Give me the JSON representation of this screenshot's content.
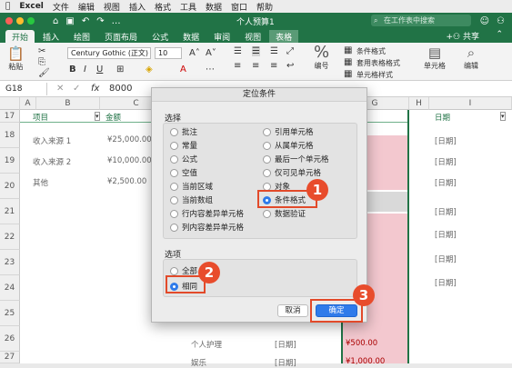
{
  "menubar": {
    "apple": "",
    "items": [
      "Excel",
      "文件",
      "编辑",
      "视图",
      "插入",
      "格式",
      "工具",
      "数据",
      "窗口",
      "帮助"
    ]
  },
  "window": {
    "title": "个人预算1",
    "search_placeholder": "在工作表中搜索",
    "share_label": "共享"
  },
  "tabs": [
    "开始",
    "插入",
    "绘图",
    "页面布局",
    "公式",
    "数据",
    "审阅",
    "视图",
    "表格"
  ],
  "active_tab": "开始",
  "ribbon": {
    "paste_label": "粘贴",
    "font_name": "Century Gothic (正文)",
    "font_size": "10",
    "number_label": "编号",
    "cond_format": "条件格式",
    "table_format": "套用表格格式",
    "cell_styles": "单元格样式",
    "cells_label": "单元格",
    "edit_label": "编辑"
  },
  "formula_bar": {
    "name_box": "G18",
    "fx": "fx",
    "value": "8000"
  },
  "columns": [
    "A",
    "B",
    "C",
    "G",
    "H",
    "I"
  ],
  "rows": [
    "17",
    "18",
    "19",
    "20",
    "21",
    "22",
    "23",
    "24",
    "25",
    "26",
    "27",
    "28"
  ],
  "sheet": {
    "header_item": "项目",
    "header_amount": "金额",
    "header_date": "日期",
    "rows": [
      {
        "item": "收入来源 1",
        "amount": "¥25,000.00",
        "date": "[日期]"
      },
      {
        "item": "收入来源 2",
        "amount": "¥10,000.00",
        "date": "[日期]"
      },
      {
        "item": "其他",
        "amount": "¥2,500.00",
        "date": "[日期]"
      }
    ],
    "bottom_item": "个人护理",
    "bottom_date": "[日期]",
    "bottom_amount": "¥500.00",
    "last_item": "娱乐",
    "last_date": "[日期]",
    "last_amount": "¥1,000.00"
  },
  "dialog": {
    "title": "定位条件",
    "select_label": "选择",
    "left_options": [
      "批注",
      "常量",
      "公式",
      "空值",
      "当前区域",
      "当前数组",
      "行内容差异单元格",
      "列内容差异单元格"
    ],
    "right_options": [
      "引用单元格",
      "从属单元格",
      "最后一个单元格",
      "仅可见单元格",
      "对象",
      "条件格式",
      "数据验证"
    ],
    "selected_option": "条件格式",
    "options_label": "选项",
    "sub_options": [
      "全部",
      "相同"
    ],
    "selected_sub": "相同",
    "cancel": "取消",
    "ok": "确定"
  },
  "badges": [
    "1",
    "2",
    "3"
  ],
  "colors": {
    "excel_green": "#217346",
    "highlight_red": "#e24a2a",
    "badge_red": "#e84c2c",
    "pink_fill": "#f3c8cf",
    "radio_blue": "#2f7bea"
  }
}
